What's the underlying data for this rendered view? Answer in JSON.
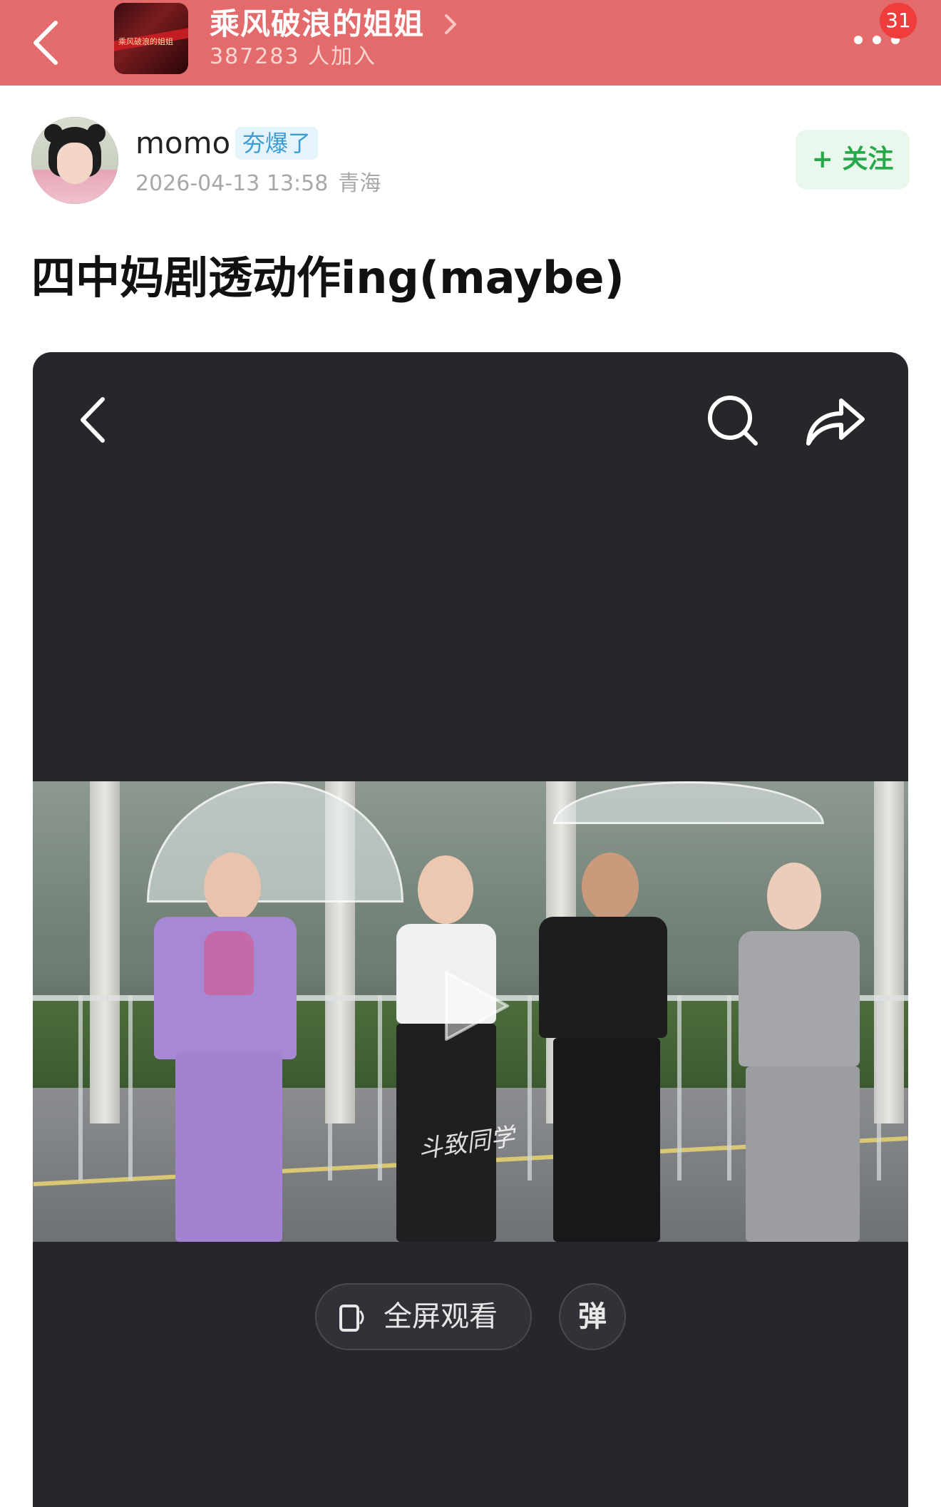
{
  "topbar": {
    "group_name": "乘风破浪的姐姐",
    "members": "387283 人加入",
    "logo_text": "乘风破浪的姐姐",
    "notification_count": "31",
    "colors": {
      "background": "#e46b6b",
      "badge": "#ef3d3d"
    }
  },
  "post": {
    "author": "momo",
    "badge": "夯爆了",
    "datetime": "2026-04-13 13:58",
    "location": "青海",
    "follow_label": "+ 关注",
    "title": "四中妈剧透动作ing(maybe)"
  },
  "player": {
    "watermark": "斗致同学",
    "fullscreen_label": "全屏观看",
    "danmaku_label": "弹",
    "icons": [
      "back-icon",
      "search-icon",
      "share-icon",
      "play-icon",
      "fullscreen-icon"
    ]
  }
}
